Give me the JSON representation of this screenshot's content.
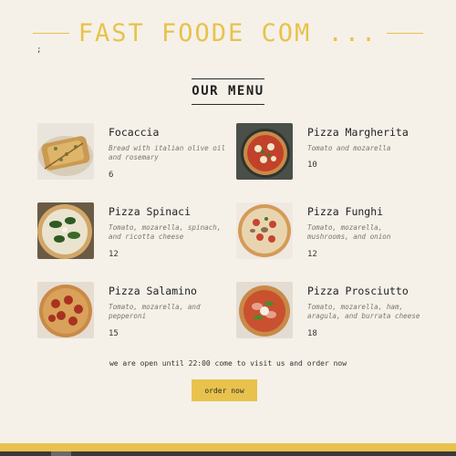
{
  "header": {
    "title": "FAST FOODE COM ...",
    "semicolon": ";"
  },
  "menu": {
    "title": "OUR MENU",
    "items": [
      {
        "name": "Focaccia",
        "desc": "Bread with italian olive oil and rosemary",
        "price": "6",
        "icon": "focaccia-photo"
      },
      {
        "name": "Pizza Margherita",
        "desc": "Tomato and mozarella",
        "price": "10",
        "icon": "pizza-margherita-photo"
      },
      {
        "name": "Pizza Spinaci",
        "desc": "Tomato, mozarella, spinach, and ricotta cheese",
        "price": "12",
        "icon": "pizza-spinaci-photo"
      },
      {
        "name": "Pizza Funghi",
        "desc": "Tomato, mozarella, mushrooms, and onion",
        "price": "12",
        "icon": "pizza-funghi-photo"
      },
      {
        "name": "Pizza Salamino",
        "desc": "Tomato, mozarella, and pepperoni",
        "price": "15",
        "icon": "pizza-salamino-photo"
      },
      {
        "name": "Pizza Prosciutto",
        "desc": "Tomato, mozarella, ham, aragula, and burrata cheese",
        "price": "18",
        "icon": "pizza-prosciutto-photo"
      }
    ]
  },
  "footer_text": "we are open until 22:00 come to visit us and order now",
  "order_button": "order now",
  "colors": {
    "accent": "#e8c24c",
    "background": "#f5f1e9"
  }
}
